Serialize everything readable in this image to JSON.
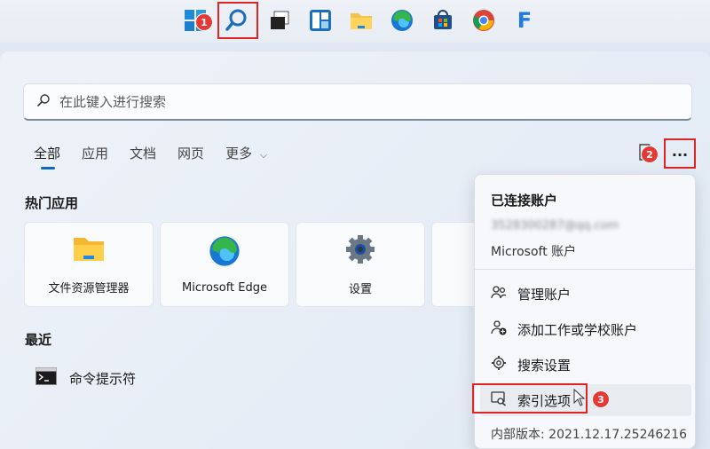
{
  "taskbar": {
    "icons": [
      "windows-start-icon",
      "search-icon",
      "task-view-icon",
      "widgets-icon",
      "file-explorer-icon",
      "edge-icon",
      "store-icon",
      "chrome-icon",
      "f-app-icon"
    ],
    "f_letter": "F"
  },
  "annotations": {
    "step1": "1",
    "step2": "2",
    "step3": "3"
  },
  "search": {
    "placeholder": "在此键入进行搜索"
  },
  "tabs": [
    {
      "label": "全部"
    },
    {
      "label": "应用"
    },
    {
      "label": "文档"
    },
    {
      "label": "网页"
    },
    {
      "label": "更多"
    }
  ],
  "pinned": {
    "title": "热门应用",
    "apps": [
      {
        "label": "文件资源管理器"
      },
      {
        "label": "Microsoft Edge"
      },
      {
        "label": "设置"
      }
    ]
  },
  "recent": {
    "title": "最近",
    "items": [
      {
        "label": "命令提示符"
      }
    ]
  },
  "more_button_label": "···",
  "menu": {
    "header": "已连接账户",
    "email": "3528300287@qq.com",
    "account_type": "Microsoft 账户",
    "items": [
      {
        "label": "管理账户"
      },
      {
        "label": "添加工作或学校账户"
      },
      {
        "label": "搜索设置"
      },
      {
        "label": "索引选项"
      }
    ],
    "version": "内部版本: 2021.12.17.25246216"
  },
  "colors": {
    "accent": "#1468b8",
    "highlight_red": "#e02424"
  }
}
